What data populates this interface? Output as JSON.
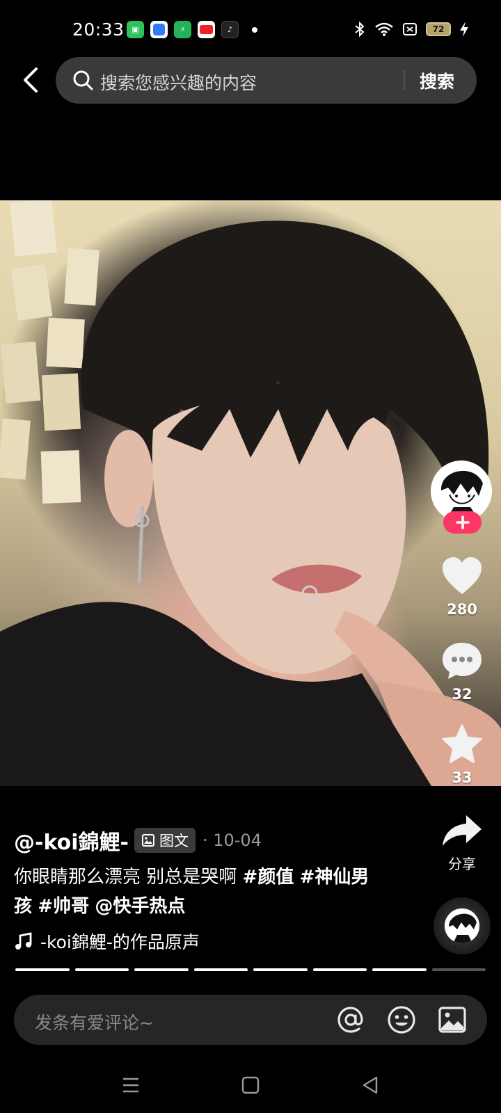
{
  "status_bar": {
    "time": "20:33",
    "battery": "72",
    "app_icons": [
      "wechat-icon",
      "browser-icon",
      "security-icon",
      "pinduoduo-icon",
      "tiktok-icon"
    ]
  },
  "header": {
    "search_placeholder": "搜索您感兴趣的内容",
    "search_button": "搜索"
  },
  "actions": {
    "like_count": "280",
    "comment_count": "32",
    "favorite_count": "33",
    "share_label": "分享"
  },
  "post": {
    "author": "@-koi錦鯉-",
    "type_badge": "图文",
    "date": "· 10-04",
    "caption_text": "你眼睛那么漂亮 别总是哭啊 ",
    "tags": [
      "#颜值",
      "#神仙男孩",
      "#帅哥",
      "@快手热点"
    ],
    "music": "-koi錦鯉-的作品原声"
  },
  "progress": {
    "total_segments": 8,
    "completed_segments": 7
  },
  "comment_bar": {
    "placeholder": "发条有爱评论~"
  },
  "colors": {
    "accent": "#fe3666",
    "background": "#000000",
    "search_bg": "#3a3a3a"
  }
}
